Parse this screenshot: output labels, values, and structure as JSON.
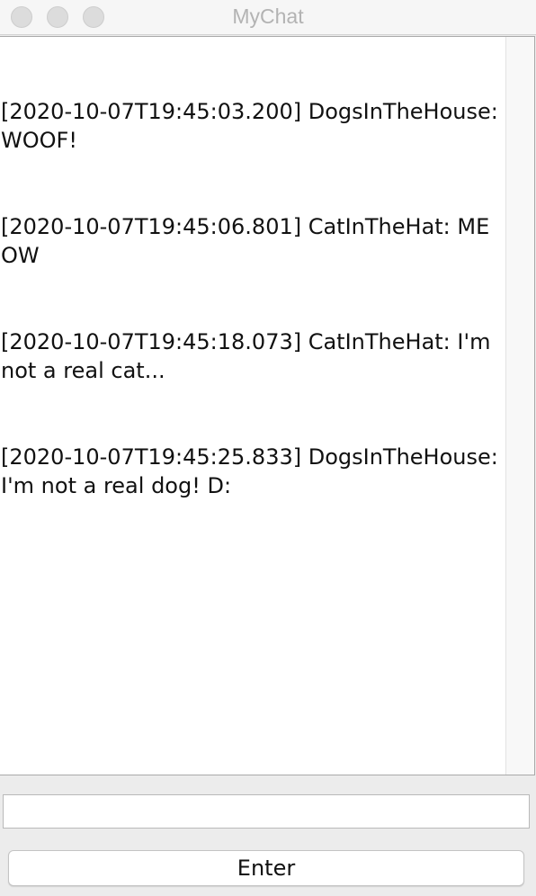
{
  "window": {
    "title": "MyChat"
  },
  "chat": {
    "messages": [
      "[2020-10-07T19:45:03.200] DogsInTheHouse: WOOF!",
      "[2020-10-07T19:45:06.801] CatInTheHat: MEOW",
      "[2020-10-07T19:45:18.073] CatInTheHat: I'm not a real cat...",
      "[2020-10-07T19:45:25.833] DogsInTheHouse: I'm not a real dog! D:"
    ]
  },
  "input": {
    "value": "",
    "placeholder": ""
  },
  "button": {
    "enter_label": "Enter"
  }
}
